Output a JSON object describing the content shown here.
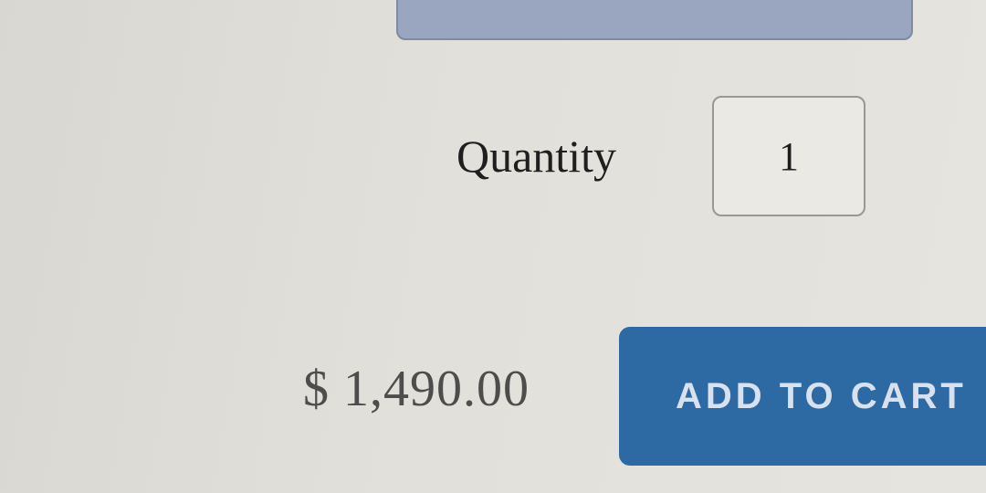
{
  "product": {
    "quantity_label": "Quantity",
    "quantity_value": "1",
    "price": "$ 1,490.00",
    "add_to_cart_label": "ADD TO CART"
  },
  "colors": {
    "button_background": "#2d6aa4",
    "button_text": "#d8e2ee",
    "top_bar": "#9aa6bf",
    "page_background": "#e2e0da"
  }
}
